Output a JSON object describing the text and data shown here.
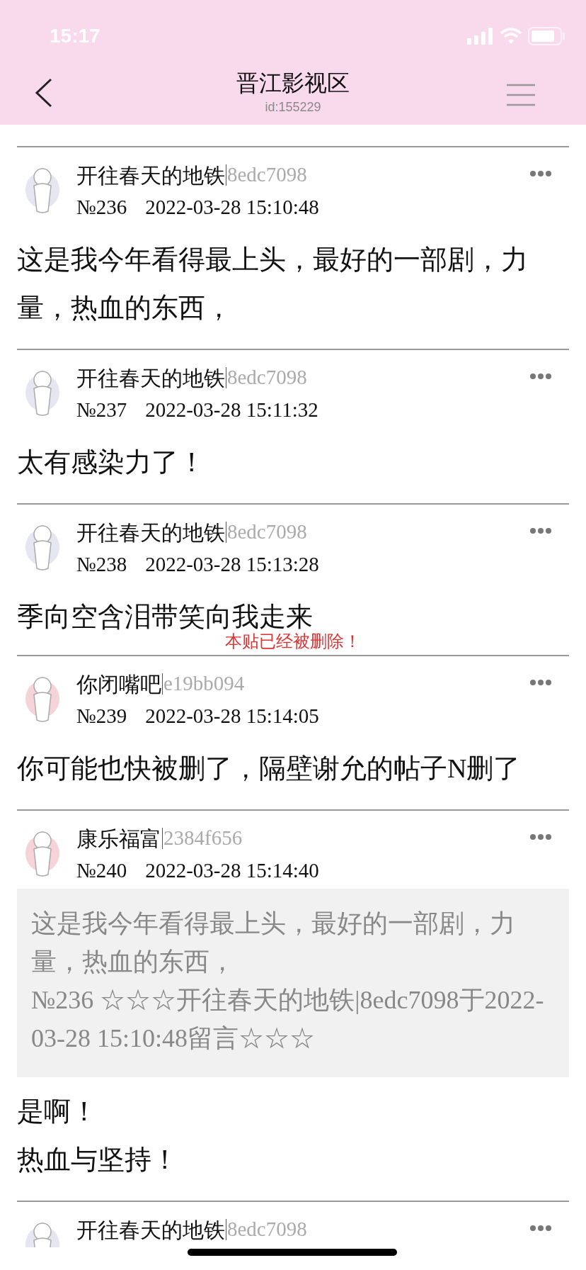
{
  "status_bar": {
    "time": "15:17"
  },
  "header": {
    "title": "晋江影视区",
    "subtitle": "id:155229"
  },
  "posts": [
    {
      "author": "开往春天的地铁",
      "user_id": "8edc7098",
      "number": "№236",
      "time": "2022-03-28 15:10:48",
      "color": "#e6e6f2",
      "body": [
        "这是我今年看得最上头，最好的一部剧，力量，热血的东西，"
      ]
    },
    {
      "author": "开往春天的地铁",
      "user_id": "8edc7098",
      "number": "№237",
      "time": "2022-03-28 15:11:32",
      "color": "#e6e6f2",
      "body": [
        "太有感染力了！"
      ]
    },
    {
      "author": "开往春天的地铁",
      "user_id": "8edc7098",
      "number": "№238",
      "time": "2022-03-28 15:13:28",
      "color": "#e6e6f2",
      "body": [
        "季向空含泪带笑向我走来"
      ],
      "notice": "本贴已经被删除！"
    },
    {
      "author": "你闭嘴吧",
      "user_id": "e19bb094",
      "number": "№239",
      "time": "2022-03-28 15:14:05",
      "color": "#f6d3d8",
      "body": [
        "你可能也快被删了，隔壁谢允的帖子N删了"
      ]
    },
    {
      "author": "康乐福富",
      "user_id": "2384f656",
      "number": "№240",
      "time": "2022-03-28 15:14:40",
      "color": "#f6d3d8",
      "quote": [
        "这是我今年看得最上头，最好的一部剧，力量，热血的东西，",
        "№236 ☆☆☆开往春天的地铁|8edc7098于2022-03-28 15:10:48留言☆☆☆"
      ],
      "body": [
        "是啊！",
        "热血与坚持！"
      ]
    },
    {
      "author": "开往春天的地铁",
      "user_id": "8edc7098",
      "color": "#e6e6f2"
    }
  ]
}
